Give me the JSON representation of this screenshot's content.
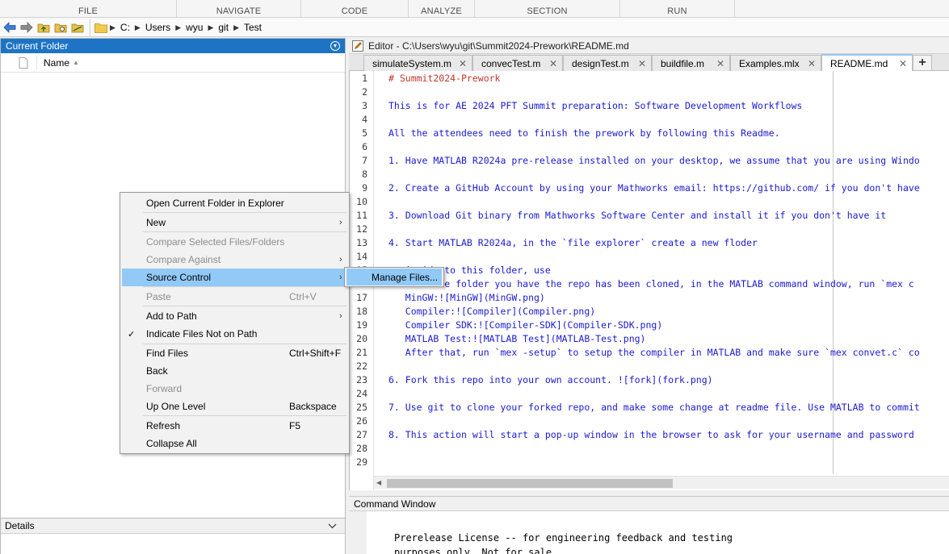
{
  "toolstrip": {
    "sections": [
      "FILE",
      "NAVIGATE",
      "CODE",
      "ANALYZE",
      "SECTION",
      "RUN"
    ]
  },
  "address_bar": {
    "path": [
      "C:",
      "Users",
      "wyu",
      "git",
      "Test"
    ]
  },
  "current_folder": {
    "title": "Current Folder",
    "column_name": "Name"
  },
  "details": {
    "title": "Details"
  },
  "editor": {
    "title": "Editor - C:\\Users\\wyu\\git\\Summit2024-Prework\\README.md",
    "tabs": [
      {
        "label": "simulateSystem.m"
      },
      {
        "label": "convecTest.m"
      },
      {
        "label": "designTest.m"
      },
      {
        "label": "buildfile.m"
      },
      {
        "label": "Examples.mlx"
      },
      {
        "label": "README.md",
        "active": true
      }
    ],
    "lines": [
      {
        "n": "1",
        "text": "# Summit2024-Prework"
      },
      {
        "n": "2",
        "text": ""
      },
      {
        "n": "3",
        "text": "This is for AE 2024 PFT Summit preparation: Software Development Workflows"
      },
      {
        "n": "4",
        "text": ""
      },
      {
        "n": "5",
        "text": "All the attendees need to finish the prework by following this Readme."
      },
      {
        "n": "6",
        "text": ""
      },
      {
        "n": "7",
        "text": "1. Have MATLAB R2024a pre-release installed on your desktop, we assume that you are using Windo"
      },
      {
        "n": "8",
        "text": ""
      },
      {
        "n": "9",
        "text": "2. Create a GitHub Account by using your Mathworks email: https://github.com/ if you don't have"
      },
      {
        "n": "10",
        "text": ""
      },
      {
        "n": "11",
        "text": "3. Download Git binary from Mathworks Software Center and install it if you don't have it"
      },
      {
        "n": "12",
        "text": ""
      },
      {
        "n": "13",
        "text": "4. Start MATLAB R2024a, in the `file explorer` create a new floder"
      },
      {
        "n": "14",
        "text": ""
      },
      {
        "n": "15",
        "text": "   inside to this folder, use"
      },
      {
        "n": "16",
        "text": "5. Goto the folder you have the repo has been cloned, in the MATLAB command window, run `mex c"
      },
      {
        "n": "17",
        "text": "   MinGW:![MinGW](MinGW.png)"
      },
      {
        "n": "18",
        "text": "   Compiler:![Compiler](Compiler.png)"
      },
      {
        "n": "19",
        "text": "   Compiler SDK:![Compiler-SDK](Compiler-SDK.png)"
      },
      {
        "n": "20",
        "text": "   MATLAB Test:![MATLAB Test](MATLAB-Test.png)"
      },
      {
        "n": "21",
        "text": "   After that, run `mex -setup` to setup the compiler in MATLAB and make sure `mex convet.c` co"
      },
      {
        "n": "22",
        "text": ""
      },
      {
        "n": "23",
        "text": "6. Fork this repo into your own account. ![fork](fork.png)"
      },
      {
        "n": "24",
        "text": ""
      },
      {
        "n": "25",
        "text": "7. Use git to clone your forked repo, and make some change at readme file. Use MATLAB to commit"
      },
      {
        "n": "26",
        "text": ""
      },
      {
        "n": "27",
        "text": "8. This action will start a pop-up window in the browser to ask for your username and password"
      },
      {
        "n": "28",
        "text": ""
      },
      {
        "n": "29",
        "text": ""
      }
    ]
  },
  "command_window": {
    "title": "Command Window",
    "lines": [
      "Prerelease License -- for engineering feedback and testing",
      "purposes only. Not for sale."
    ]
  },
  "context_menu": {
    "open_in_explorer": "Open Current Folder in Explorer",
    "new": "New",
    "compare_selected": "Compare Selected Files/Folders",
    "compare_against": "Compare Against",
    "source_control": "Source Control",
    "paste": "Paste",
    "paste_shortcut": "Ctrl+V",
    "add_to_path": "Add to Path",
    "indicate_files": "Indicate Files Not on Path",
    "find_files": "Find Files",
    "find_files_shortcut": "Ctrl+Shift+F",
    "back": "Back",
    "forward": "Forward",
    "up_one_level": "Up One Level",
    "up_one_level_shortcut": "Backspace",
    "refresh": "Refresh",
    "refresh_shortcut": "F5",
    "collapse_all": "Collapse All"
  },
  "submenu": {
    "manage_files": "Manage Files..."
  },
  "colors": {
    "pane_title": "#1e74c4",
    "menu_highlight": "#91c9f7",
    "code_text": "#1a1ad0",
    "heading": "#c0392b",
    "link_label": "#2e8b57"
  }
}
